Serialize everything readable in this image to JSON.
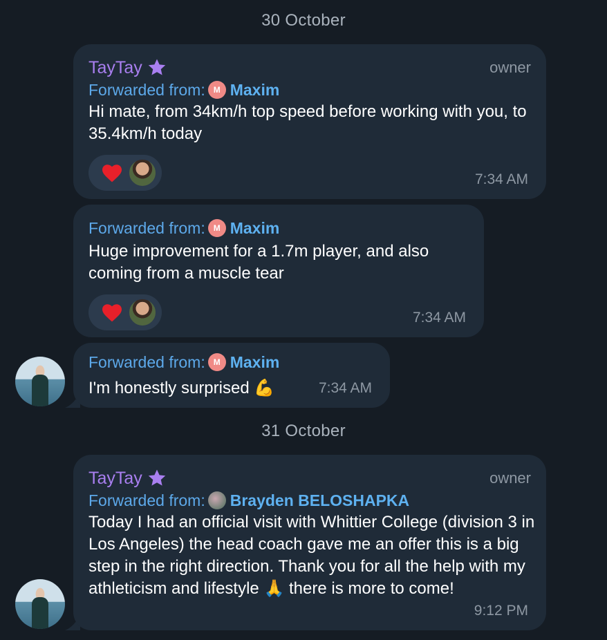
{
  "dates": [
    "30 October",
    "31 October"
  ],
  "messages": [
    {
      "sender": "TayTay",
      "role": "owner",
      "forward_label": "Forwarded from:",
      "forward_name": "Maxim",
      "forward_initial": "M",
      "text": "Hi mate, from 34km/h top speed before working with you, to 35.4km/h today",
      "time": "7:34 AM"
    },
    {
      "forward_label": "Forwarded from:",
      "forward_name": "Maxim",
      "forward_initial": "M",
      "text": "Huge improvement for a 1.7m player, and also coming from a muscle tear",
      "time": "7:34 AM"
    },
    {
      "forward_label": "Forwarded from:",
      "forward_name": "Maxim",
      "forward_initial": "M",
      "text": "I'm honestly surprised 💪",
      "time": "7:34 AM"
    },
    {
      "sender": "TayTay",
      "role": "owner",
      "forward_label": "Forwarded from:",
      "forward_name": "Brayden BELOSHAPKA",
      "text": "Today I had an official visit with Whittier College (division 3 in Los Angeles) the head coach gave me an offer this is a big step in the right direction. Thank you for all the help with my athleticism and lifestyle 🙏  there is more to come!",
      "time": "9:12 PM"
    }
  ],
  "colors": {
    "background": "#151c24",
    "bubble": "#1f2b38",
    "sender": "#a97ff0",
    "forward": "#5da9ea",
    "meta": "#8e98a3"
  }
}
